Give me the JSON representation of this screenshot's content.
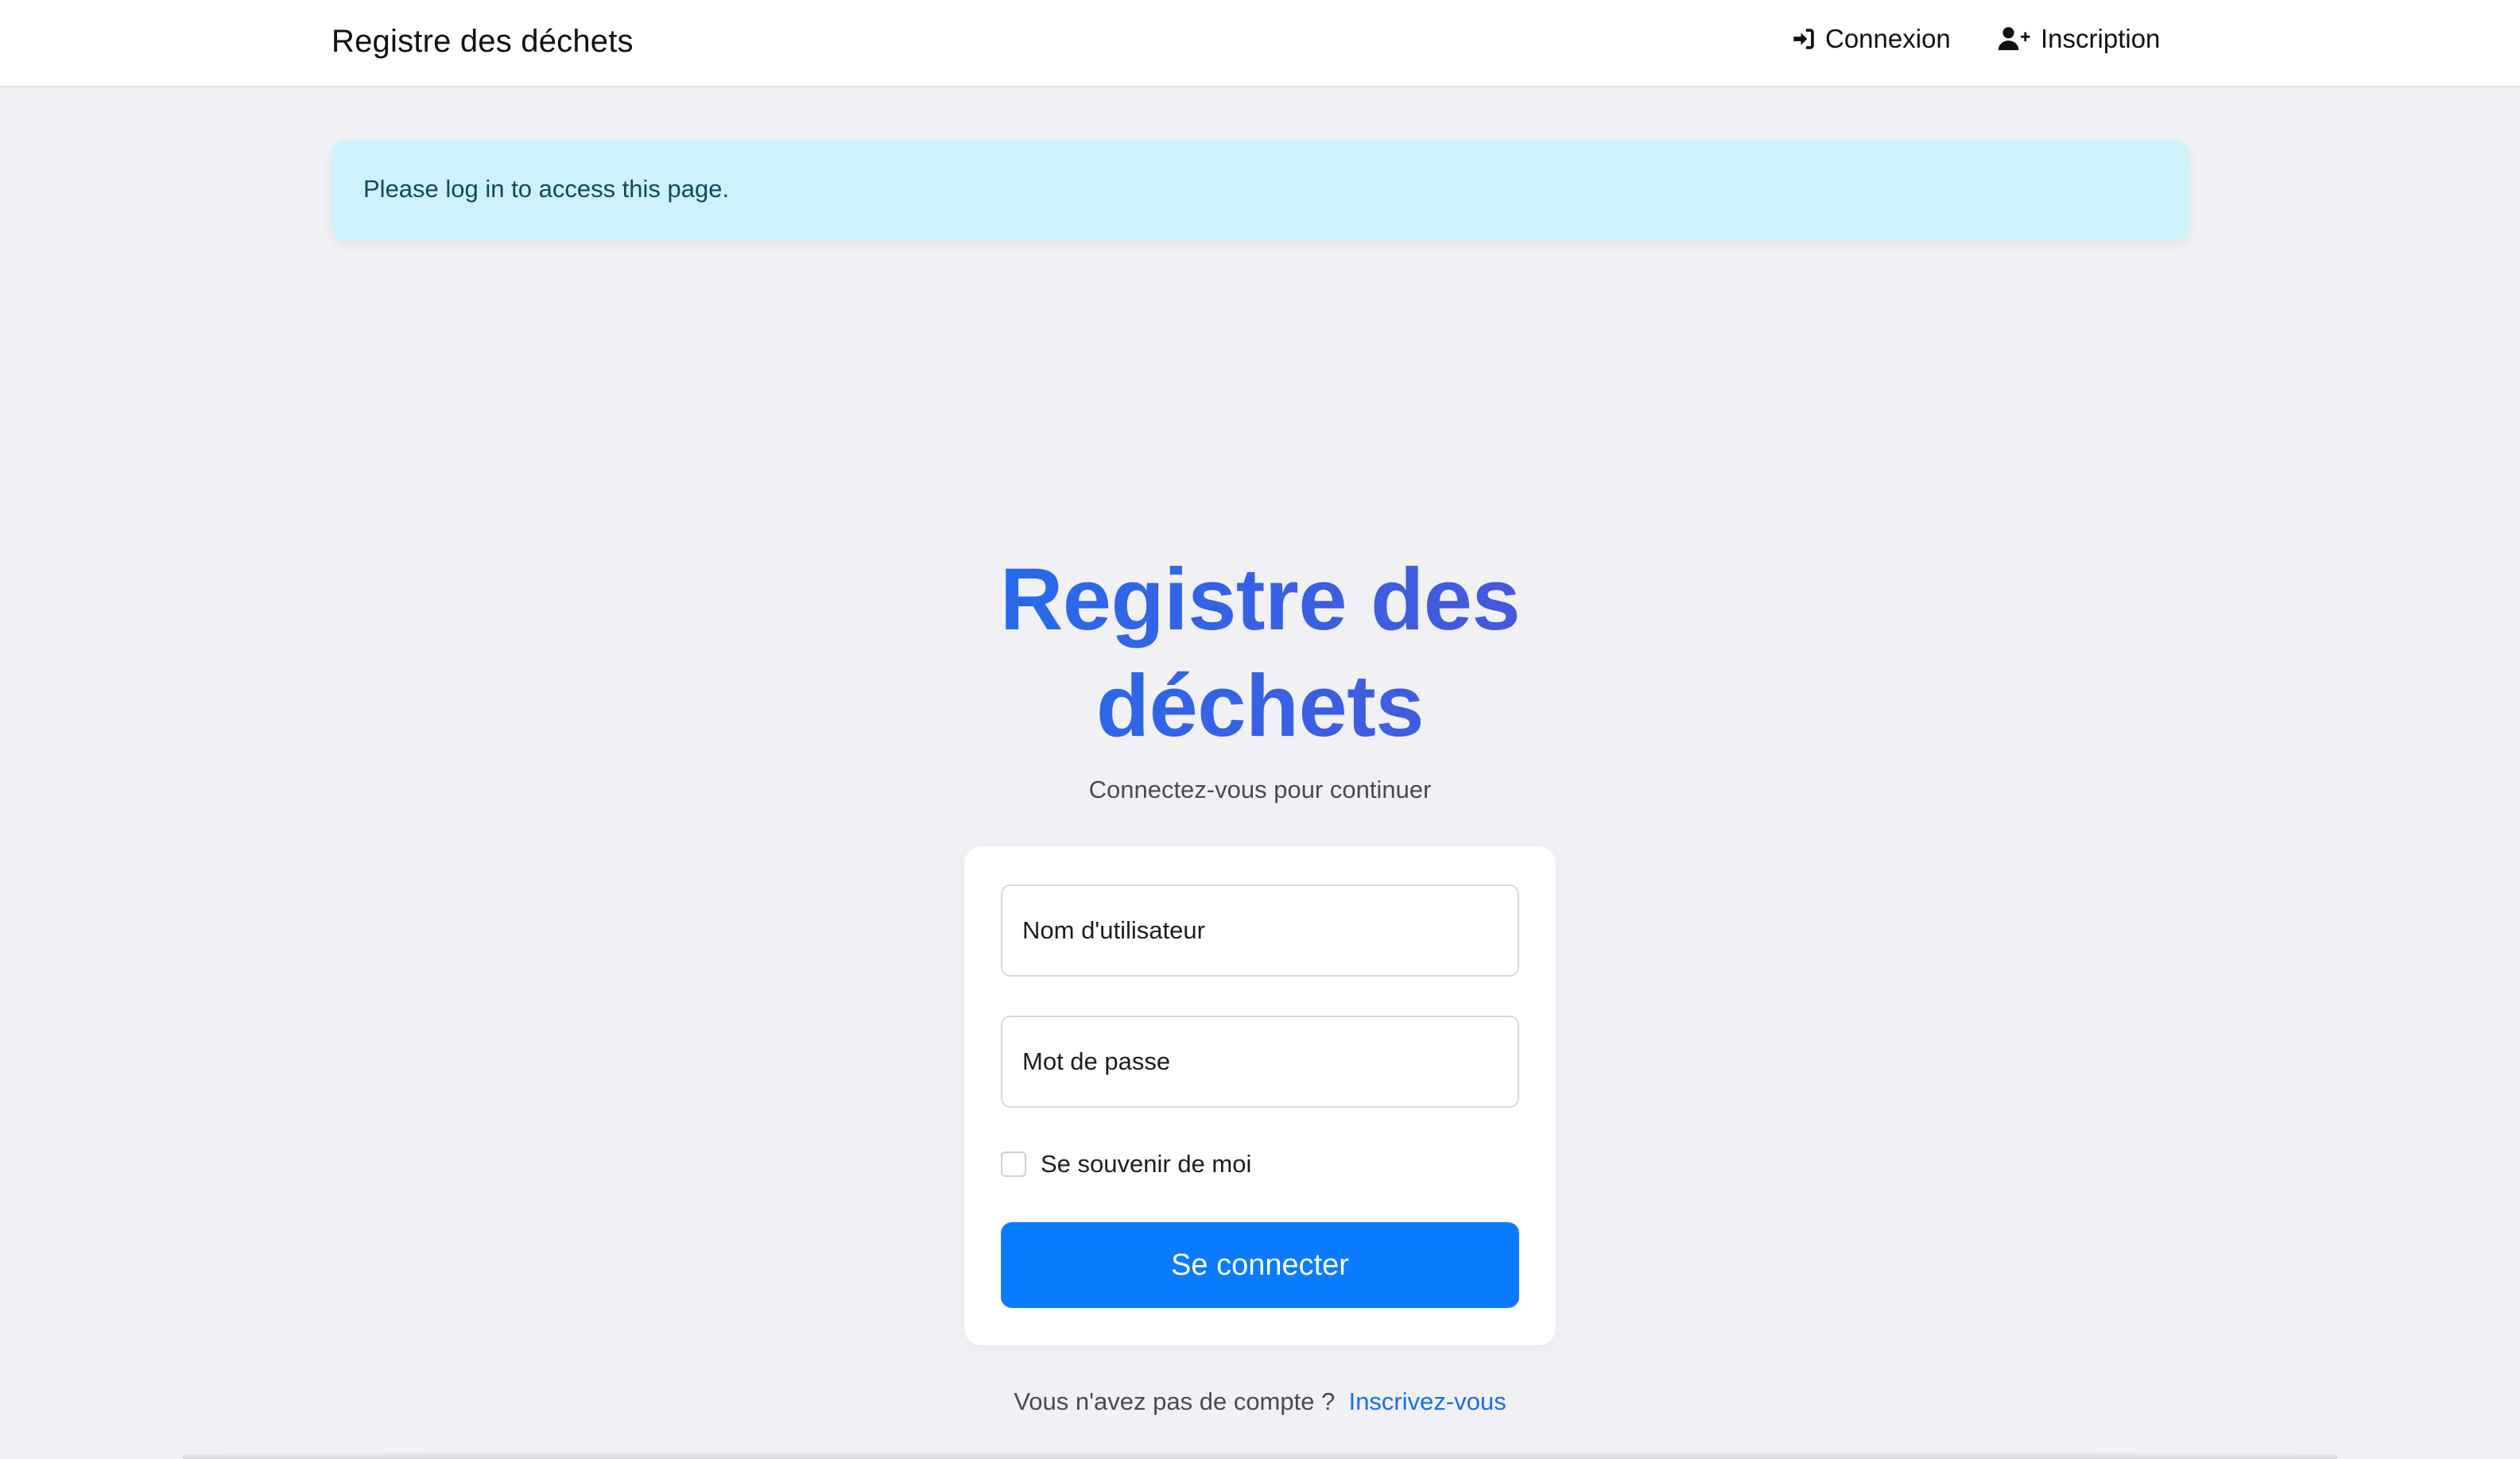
{
  "navbar": {
    "brand": "Registre des déchets",
    "login_label": "Connexion",
    "login_icon": "sign-in-icon",
    "register_label": "Inscription",
    "register_icon": "user-plus-icon"
  },
  "alert": {
    "message": "Please log in to access this page."
  },
  "hero": {
    "title": "Registre des déchets",
    "subtitle": "Connectez-vous pour continuer"
  },
  "form": {
    "username_placeholder": "Nom d'utilisateur",
    "username_value": "",
    "password_placeholder": "Mot de passe",
    "password_value": "",
    "remember_label": "Se souvenir de moi",
    "remember_checked": false,
    "submit_label": "Se connecter"
  },
  "signup": {
    "prompt": "Vous n'avez pas de compte ?",
    "link_label": "Inscrivez-vous"
  },
  "colors": {
    "page_background": "#f1f1f5",
    "alert_background": "#cff1fb",
    "primary_button": "#0a7bff",
    "title_gradient_start": "#1f6ff0",
    "title_gradient_end": "#4a56d8",
    "link": "#1a6fe6"
  }
}
